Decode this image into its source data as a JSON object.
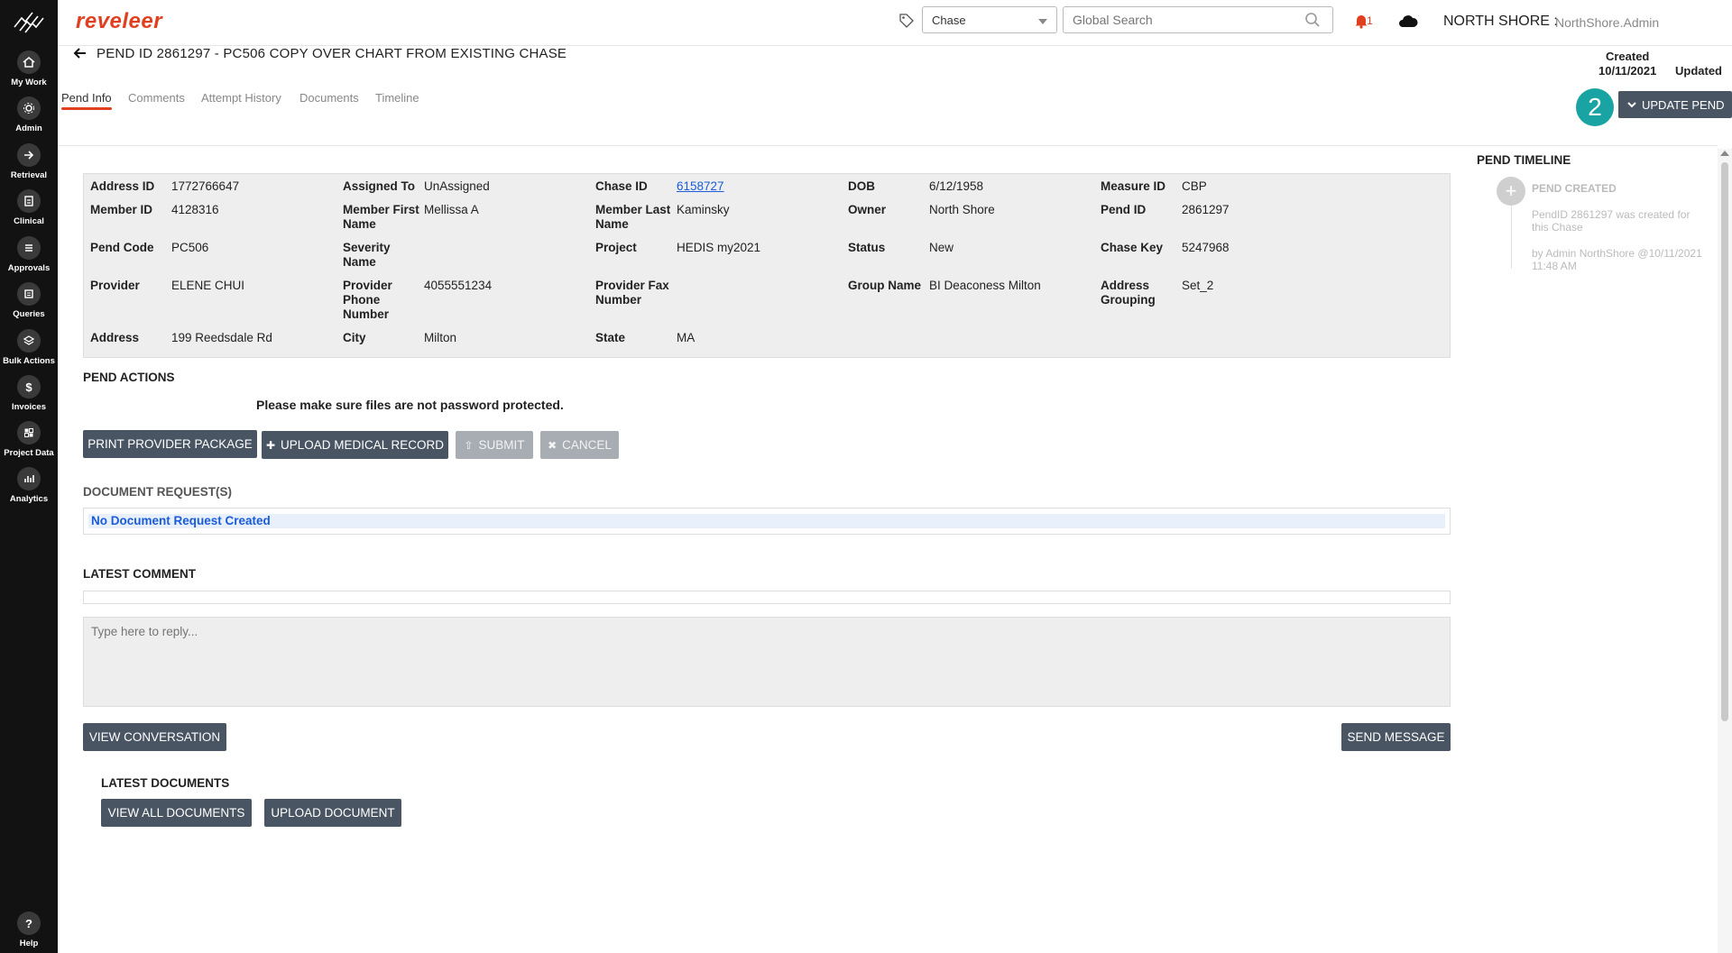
{
  "brand": "reveleer",
  "header": {
    "chase_select": "Chase",
    "search_placeholder": "Global Search",
    "notification_count": "1",
    "org_name": "NORTH SHORE :",
    "org_user": "NorthShore.Admin"
  },
  "sidebar": {
    "items": [
      {
        "label": "My Work",
        "icon": "home-icon"
      },
      {
        "label": "Admin",
        "icon": "gear-icon"
      },
      {
        "label": "Retrieval",
        "icon": "arrow-right-icon"
      },
      {
        "label": "Clinical",
        "icon": "clipboard-icon"
      },
      {
        "label": "Approvals",
        "icon": "list-icon"
      },
      {
        "label": "Queries",
        "icon": "document-icon"
      },
      {
        "label": "Bulk Actions",
        "icon": "layers-icon"
      },
      {
        "label": "Invoices",
        "icon": "dollar-icon"
      },
      {
        "label": "Project Data",
        "icon": "grid-icon"
      },
      {
        "label": "Analytics",
        "icon": "bar-chart-icon"
      },
      {
        "label": "Help",
        "icon": "question-icon"
      }
    ]
  },
  "page": {
    "title": "PEND ID 2861297 - PC506 COPY OVER CHART FROM EXISTING CHASE",
    "created_label": "Created",
    "created_date": "10/11/2021",
    "updated_label": "Updated",
    "step_badge": "2",
    "update_button": "UPDATE PEND"
  },
  "tabs": [
    "Pend Info",
    "Comments",
    "Attempt History",
    "Documents",
    "Timeline"
  ],
  "info": {
    "address_id": {
      "label": "Address ID",
      "value": "1772766647"
    },
    "assigned_to": {
      "label": "Assigned To",
      "value": "UnAssigned"
    },
    "chase_id": {
      "label": "Chase ID",
      "value": "6158727"
    },
    "dob": {
      "label": "DOB",
      "value": "6/12/1958"
    },
    "measure_id": {
      "label": "Measure ID",
      "value": "CBP"
    },
    "member_id": {
      "label": "Member ID",
      "value": "4128316"
    },
    "member_first_name": {
      "label": "Member First Name",
      "value": "Mellissa A"
    },
    "member_last_name": {
      "label": "Member Last Name",
      "value": "Kaminsky"
    },
    "owner": {
      "label": "Owner",
      "value": "North Shore"
    },
    "pend_id": {
      "label": "Pend ID",
      "value": "2861297"
    },
    "pend_code": {
      "label": "Pend Code",
      "value": "PC506"
    },
    "severity_name": {
      "label": "Severity Name",
      "value": ""
    },
    "project": {
      "label": "Project",
      "value": "HEDIS my2021"
    },
    "status": {
      "label": "Status",
      "value": "New"
    },
    "chase_key": {
      "label": "Chase Key",
      "value": "5247968"
    },
    "provider": {
      "label": "Provider",
      "value": "ELENE CHUI"
    },
    "provider_phone": {
      "label": "Provider Phone Number",
      "value": "4055551234"
    },
    "provider_fax": {
      "label": "Provider Fax Number",
      "value": ""
    },
    "group_name": {
      "label": "Group Name",
      "value": "BI Deaconess Milton"
    },
    "address_grouping": {
      "label": "Address Grouping",
      "value": "Set_2"
    },
    "address": {
      "label": "Address",
      "value": "199 Reedsdale Rd"
    },
    "city": {
      "label": "City",
      "value": "Milton"
    },
    "state": {
      "label": "State",
      "value": "MA"
    }
  },
  "actions": {
    "heading": "PEND ACTIONS",
    "notice": "Please make sure files are not password protected.",
    "print": "PRINT PROVIDER PACKAGE",
    "upload": "UPLOAD MEDICAL RECORD",
    "submit": "SUBMIT",
    "cancel": "CANCEL"
  },
  "doc_requests": {
    "heading": "DOCUMENT REQUEST(S)",
    "empty": "No Document Request Created"
  },
  "comments": {
    "heading": "LATEST COMMENT",
    "reply_placeholder": "Type here to reply...",
    "view_conversation": "VIEW CONVERSATION",
    "send_message": "SEND MESSAGE"
  },
  "documents": {
    "heading": "LATEST DOCUMENTS",
    "view_all": "VIEW ALL DOCUMENTS",
    "upload": "UPLOAD DOCUMENT"
  },
  "timeline": {
    "heading": "PEND TIMELINE",
    "event_title": "PEND CREATED",
    "event_desc": "PendID 2861297 was created for this Chase",
    "event_by": "by Admin NorthShore @10/11/2021 11:48 AM"
  },
  "colors": {
    "brand": "#e0401f",
    "button": "#4a5563",
    "badge": "#1aa3a3",
    "link": "#1a5bd8"
  }
}
